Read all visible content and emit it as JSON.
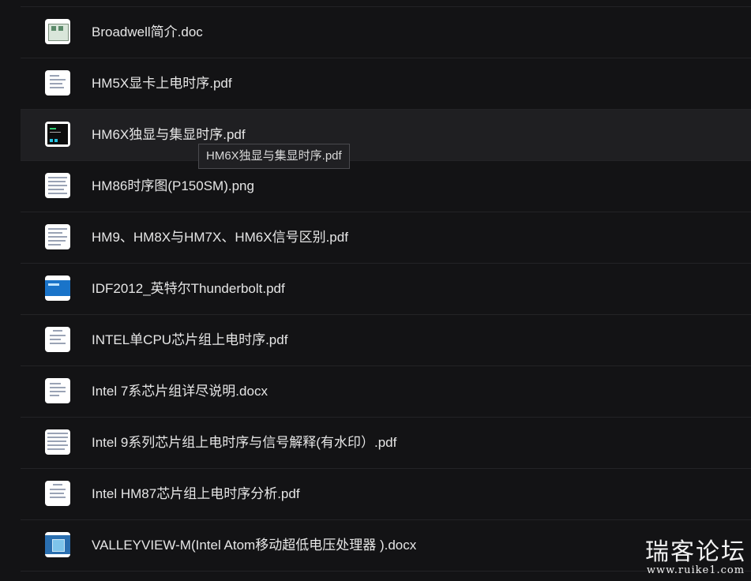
{
  "files": [
    {
      "name": "Broadwell简介.doc",
      "thumb": "board-photo-thumbnail"
    },
    {
      "name": "HM5X显卡上电时序.pdf",
      "thumb": "document-thumbnail"
    },
    {
      "name": "HM6X独显与集显时序.pdf",
      "thumb": "dark-screenshot-thumbnail"
    },
    {
      "name": "HM86时序图(P150SM).png",
      "thumb": "document-thumbnail"
    },
    {
      "name": "HM9、HM8X与HM7X、HM6X信号区别.pdf",
      "thumb": "document-thumbnail"
    },
    {
      "name": "IDF2012_英特尔Thunderbolt.pdf",
      "thumb": "blue-slide-thumbnail"
    },
    {
      "name": "INTEL单CPU芯片组上电时序.pdf",
      "thumb": "document-thumbnail"
    },
    {
      "name": "Intel 7系芯片组详尽说明.docx",
      "thumb": "document-thumbnail"
    },
    {
      "name": "Intel 9系列芯片组上电时序与信号解释(有水印）.pdf",
      "thumb": "document-thumbnail"
    },
    {
      "name": "Intel HM87芯片组上电时序分析.pdf",
      "thumb": "document-thumbnail"
    },
    {
      "name": "VALLEYVIEW-M(Intel Atom移动超低电压处理器 ).docx",
      "thumb": "atom-slide-thumbnail"
    }
  ],
  "hovered_index": 2,
  "tooltip": "HM6X独显与集显时序.pdf",
  "watermark": {
    "title": "瑞客论坛",
    "url": "www.ruike1.com"
  }
}
